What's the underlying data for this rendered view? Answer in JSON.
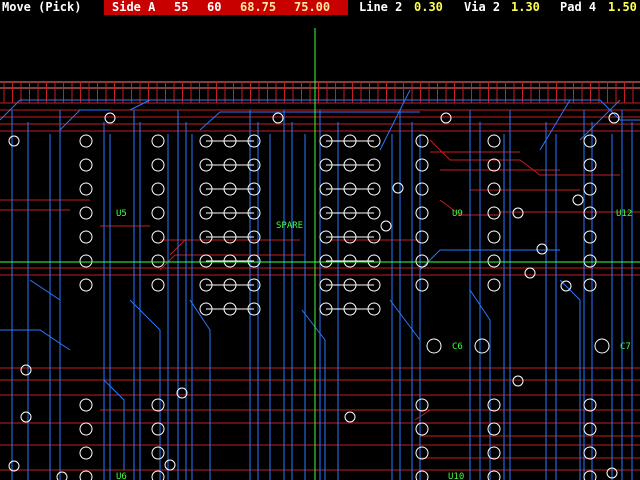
{
  "statusbar": {
    "mode": "Move (Pick)",
    "side_label": "Side A",
    "coord_a": "55",
    "coord_b": "60",
    "coord_c": "68.75",
    "coord_d": "75.00",
    "line_label": "Line 2",
    "line_value": "0.30",
    "via_label": "Via 2",
    "via_value": "1.30",
    "pad_label": "Pad 4",
    "pad_value": "1.50"
  },
  "components": [
    {
      "ref": "U5"
    },
    {
      "ref": "SPARE"
    },
    {
      "ref": "U9"
    },
    {
      "ref": "U12"
    },
    {
      "ref": "C6"
    },
    {
      "ref": "C7"
    },
    {
      "ref": "U6"
    },
    {
      "ref": "U10"
    }
  ],
  "colors": {
    "trace_red": "#c81e1e",
    "trace_blue": "#2878ff",
    "pad": "#ffffff",
    "label": "#40ff40",
    "crosshair": "#40ff40"
  }
}
